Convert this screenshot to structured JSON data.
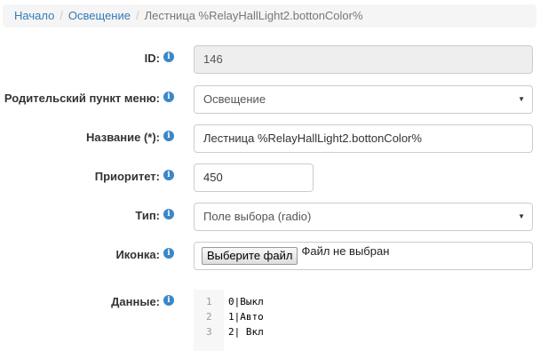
{
  "breadcrumb": {
    "home": "Начало",
    "section": "Освещение",
    "current": "Лестница %RelayHallLight2.bottonColor%"
  },
  "form": {
    "id": {
      "label": "ID:",
      "value": "146"
    },
    "parent": {
      "label": "Родительский пункт меню:",
      "value": "Освещение"
    },
    "name": {
      "label": "Название (*):",
      "value": "Лестница %RelayHallLight2.bottonColor%"
    },
    "priority": {
      "label": "Приоритет:",
      "value": "450"
    },
    "type": {
      "label": "Тип:",
      "value": "Поле выбора (radio)"
    },
    "icon": {
      "label": "Иконка:",
      "button": "Выберите файл",
      "status": "Файл не выбран"
    },
    "data": {
      "label": "Данные:",
      "lines": [
        {
          "num": "1",
          "text": "0|Выкл"
        },
        {
          "num": "2",
          "text": "1|Авто"
        },
        {
          "num": "3",
          "text": "2| Вкл"
        }
      ]
    }
  },
  "info_glyph": "i",
  "caret_glyph": "▼"
}
